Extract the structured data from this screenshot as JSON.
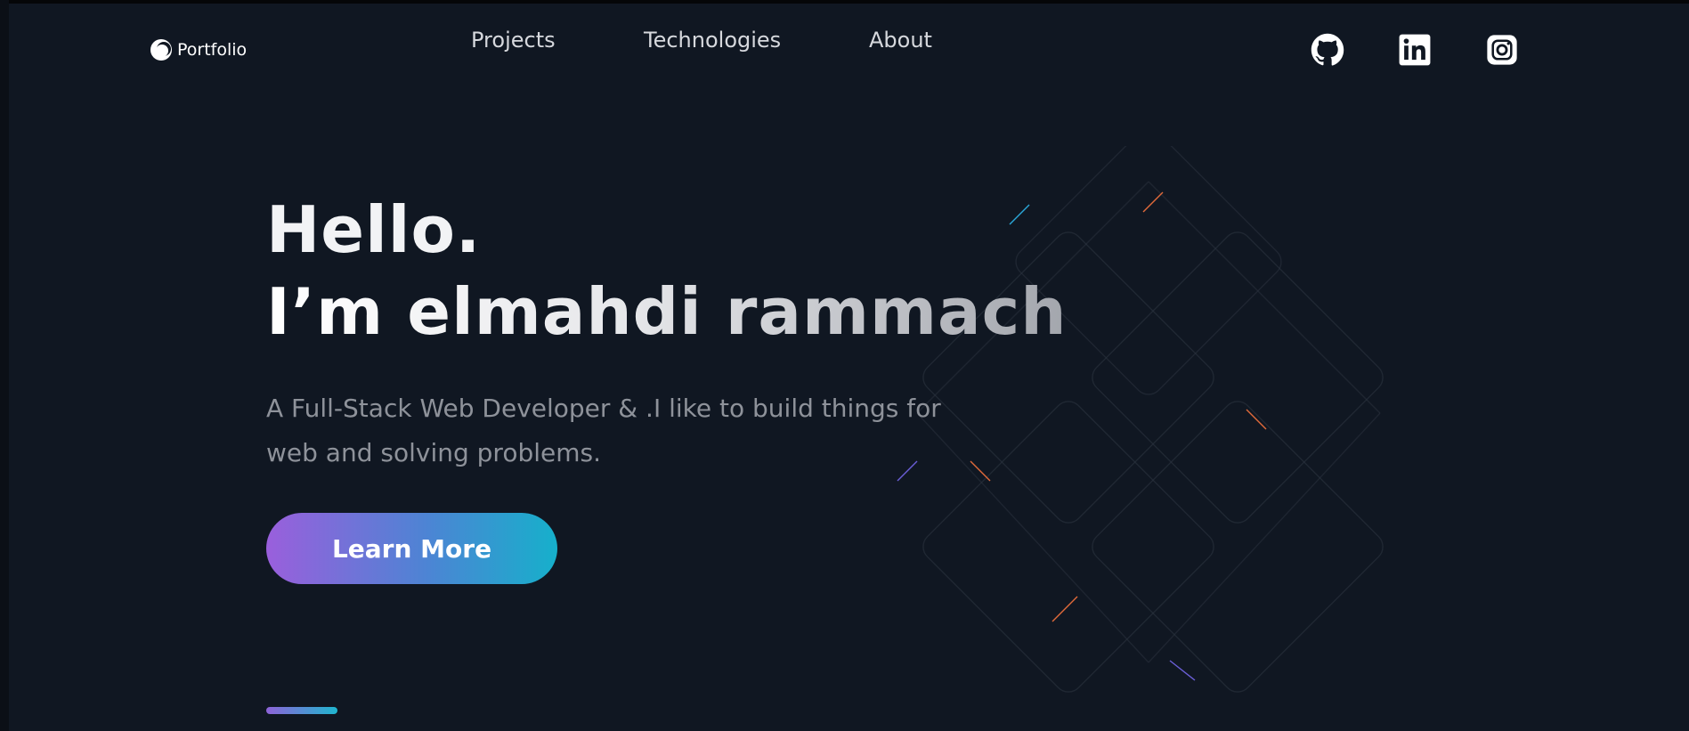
{
  "header": {
    "logo_text": "Portfolio",
    "nav": [
      {
        "label": "Projects"
      },
      {
        "label": "Technologies"
      },
      {
        "label": "About"
      }
    ],
    "social_icons": [
      "github-icon",
      "linkedin-icon",
      "instagram-icon"
    ]
  },
  "hero": {
    "greeting": "Hello.",
    "name_line": "I’m elmahdi rammach",
    "subtitle": "A Full-Stack Web Developer & .I like to build things for web and solving problems.",
    "cta_label": "Learn More"
  },
  "colors": {
    "background": "#101722",
    "text_primary": "#f2f3f5",
    "text_muted": "#8e929a",
    "cta_gradient_start": "#9a5fdc",
    "cta_gradient_end": "#16b0cb"
  }
}
